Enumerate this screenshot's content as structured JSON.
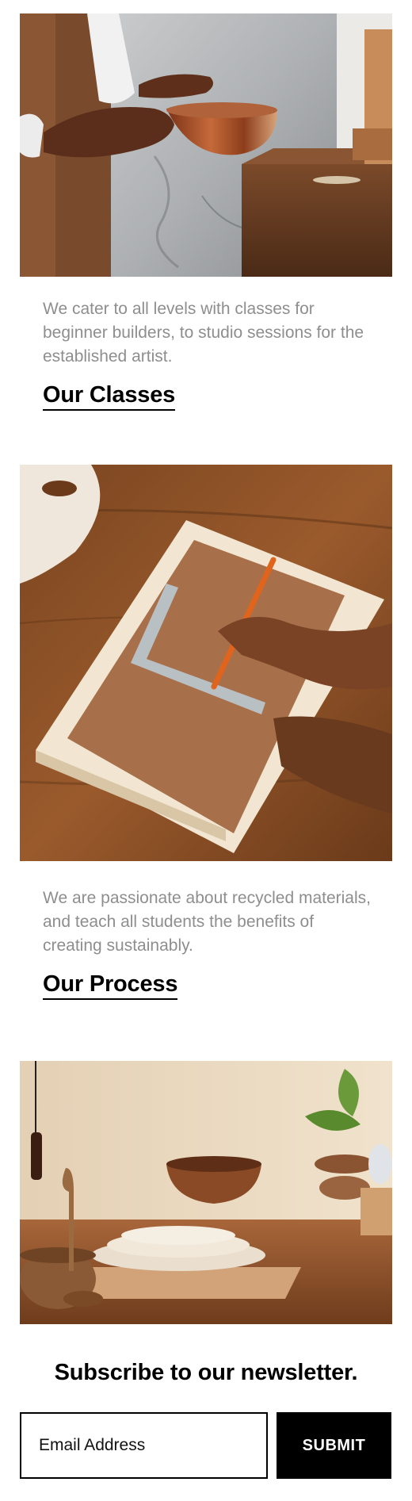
{
  "sections": [
    {
      "description": "We cater to all levels with classes for beginner builders, to studio sessions for the established artist.",
      "link_label": "Our Classes"
    },
    {
      "description": "We are passionate about recycled materials, and teach all students the benefits of creating sustainably.",
      "link_label": "Our Process"
    }
  ],
  "newsletter": {
    "title": "Subscribe to our newsletter.",
    "email_placeholder": "Email Address",
    "email_value": "",
    "submit_label": "SUBMIT"
  },
  "colors": {
    "body_text": "#8e8e8e",
    "heading_text": "#000000",
    "button_bg": "#000000",
    "button_text": "#ffffff"
  }
}
